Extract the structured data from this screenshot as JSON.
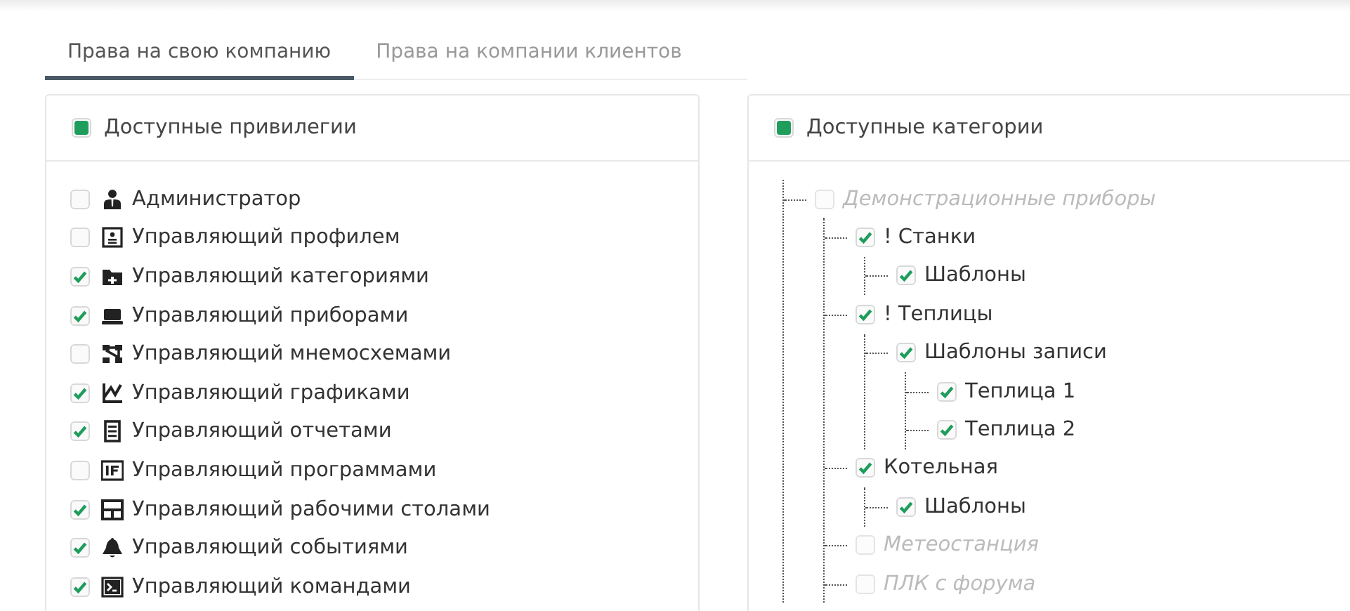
{
  "tabs": [
    {
      "label": "Права на свою компанию",
      "selected": true
    },
    {
      "label": "Права на компании клиентов",
      "selected": false
    }
  ],
  "privileges": {
    "title": "Доступные привилегии",
    "partial": true,
    "items": [
      {
        "label": "Администратор",
        "checked": false,
        "kind": "user"
      },
      {
        "label": "Управляющий профилем",
        "checked": false,
        "kind": "profile"
      },
      {
        "label": "Управляющий категориями",
        "checked": true,
        "kind": "folder"
      },
      {
        "label": "Управляющий приборами",
        "checked": true,
        "kind": "laptop"
      },
      {
        "label": "Управляющий мнемосхемами",
        "checked": false,
        "kind": "diagram"
      },
      {
        "label": "Управляющий графиками",
        "checked": true,
        "kind": "chart"
      },
      {
        "label": "Управляющий отчетами",
        "checked": true,
        "kind": "report"
      },
      {
        "label": "Управляющий программами",
        "checked": false,
        "kind": "program"
      },
      {
        "label": "Управляющий рабочими столами",
        "checked": true,
        "kind": "layout"
      },
      {
        "label": "Управляющий событиями",
        "checked": true,
        "kind": "bell"
      },
      {
        "label": "Управляющий командами",
        "checked": true,
        "kind": "terminal"
      }
    ]
  },
  "categories": {
    "title": "Доступные категории",
    "partial": true,
    "items": [
      {
        "label": "Демонстрационные приборы",
        "checked": false,
        "disabled": true,
        "children": [
          {
            "label": "! Станки",
            "checked": true,
            "disabled": false,
            "children": [
              {
                "label": "Шаблоны",
                "checked": true,
                "disabled": false
              }
            ]
          },
          {
            "label": "! Теплицы",
            "checked": true,
            "disabled": false,
            "children": [
              {
                "label": "Шаблоны записи",
                "checked": true,
                "disabled": false,
                "children": [
                  {
                    "label": "Теплица 1",
                    "checked": true,
                    "disabled": false
                  },
                  {
                    "label": "Теплица 2",
                    "checked": true,
                    "disabled": false
                  }
                ]
              }
            ]
          },
          {
            "label": "Котельная",
            "checked": true,
            "disabled": false,
            "children": [
              {
                "label": "Шаблоны",
                "checked": true,
                "disabled": false
              }
            ]
          },
          {
            "label": "Метеостанция",
            "checked": false,
            "disabled": true
          },
          {
            "label": "ПЛК с форума",
            "checked": false,
            "disabled": true
          }
        ]
      }
    ]
  }
}
